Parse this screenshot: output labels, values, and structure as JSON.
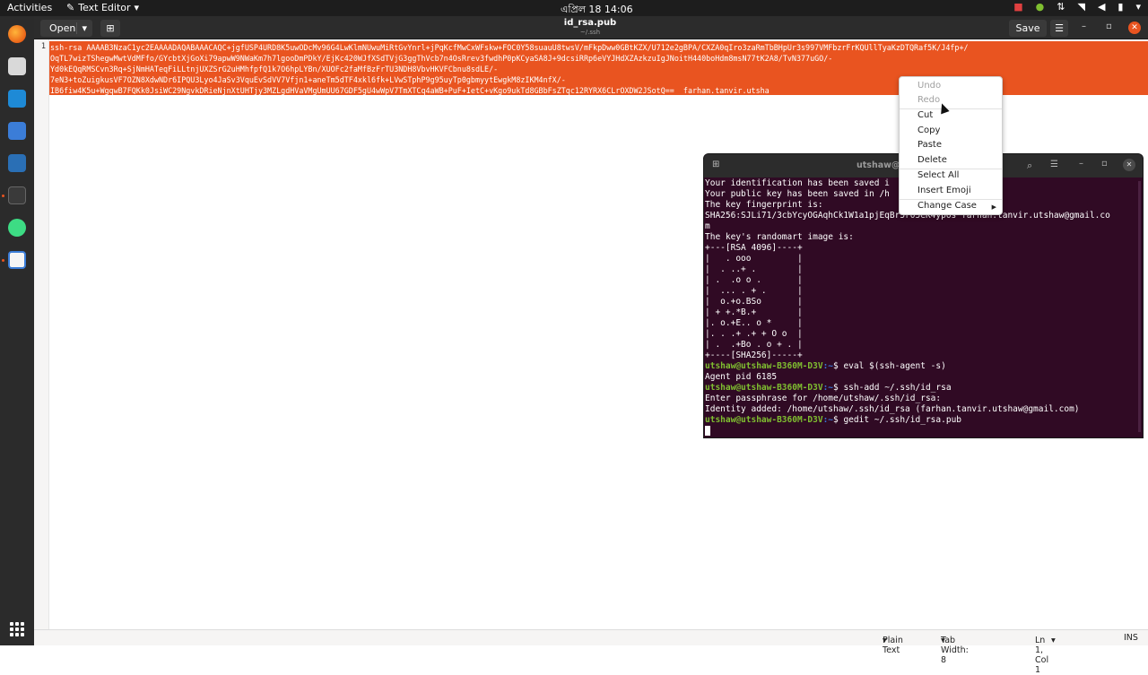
{
  "topbar": {
    "activities": "Activities",
    "app_name": "Text Editor",
    "clock": "এপ্রিল 18  14:06"
  },
  "editor": {
    "open_label": "Open",
    "title": "id_rsa.pub",
    "subtitle": "~/.ssh",
    "save_label": "Save",
    "line_number": "1",
    "lines": [
      "ssh-rsa AAAAB3NzaC1yc2EAAAADAQABAAACAQC+jgfUSP4URD8K5uwODcMv96G4LwKlmNUwuMiRtGvYnrl+jPqKcfMwCxWFskw+FOC0Y58suauU8twsV/mFkpDww0GBtKZX/U712e2gBPA/CXZA0qIro3zaRmTbBHpUr3s997VMFbzrFrKQUllTyaKzDTQRaf5K/J4fp+/",
      "OqTL7wizTShegwMwtVdMFfo/GYcbtXjGoXi79apwW9NWaKm7h7lgooDmPDkY/EjKc420WJfXSdTVjG3ggThVcb7n4OsRrev3fwdhP0pKCyaSA8J+9dcsiRRp6eVYJHdXZAzkzuIgJNoitH440boHdm8msN77tK2A8/TvN377uGO/-",
      "Yd0kEQqRMSCvn3Rq+SjNmHATeqFiLLtnjUXZSrG2uHMhfpfQ1k7O6hpLYBn/XUOFc2faMfBzFrTU3NDH8VbvHKVFCbnu8sdLE/-",
      "7eN3+toZuigkusVF7OZN8XdwNDr6IPQU3Lyo4JaSv3VquEvSdVV7Vfjn1+aneTm5dTF4xkl6fk+LVwSTphP9g95uyTp0gbmyytEwgkM8zIKM4nfX/-",
      "IB6fiw4K5u+WgqwB7FQKk0JsiWC29NgvkDRieNjnXtUHTjy3MZLgdHVaVMgUmUU67GDF5gU4wWpV7TmXTCq4aWB+PuF+IetC+vKgo9ukTd8GBbFsZTqc12RYRX6CLrOXDW2JSotQ==  farhan.tanvir.utsha"
    ],
    "statusbar": {
      "language": "Plain Text",
      "tab_width": "Tab Width: 8",
      "position": "Ln 1, Col 1",
      "mode": "INS"
    }
  },
  "terminal": {
    "title": "utshaw@u",
    "lines": [
      "Your identification has been saved i          /id_rsa",
      "Your public key has been saved in /h          rsa.pub",
      "The key fingerprint is:",
      "SHA256:SJLi71/3cbYcyOGAqhCk1W1a1pjEqBr5r05eK4ypOs farhan.tanvir.utshaw@gmail.co",
      "m",
      "The key's randomart image is:",
      "+---[RSA 4096]----+",
      "|   . ooo         |",
      "|  . ..+ .        |",
      "| .  .o o .       |",
      "|  ... . + .      |",
      "|  o.+o.BSo       |",
      "| + +.*B.+        |",
      "|. o.+E.. o *     |",
      "|. . .+ .+ + O o  |",
      "| .  .+Bo . o + . |",
      "+----[SHA256]-----+"
    ],
    "prompt_user": "utshaw@utshaw-B360M-D3V",
    "prompt_path": ":~",
    "cmd1": "$ eval $(ssh-agent -s)",
    "out1": "Agent pid 6185",
    "cmd2": "$ ssh-add ~/.ssh/id_rsa",
    "out2a": "Enter passphrase for /home/utshaw/.ssh/id_rsa:",
    "out2b": "Identity added: /home/utshaw/.ssh/id_rsa (farhan.tanvir.utshaw@gmail.com)",
    "cmd3": "$ gedit ~/.ssh/id_rsa.pub"
  },
  "context_menu": {
    "items": [
      "Undo",
      "Redo",
      "Cut",
      "Copy",
      "Paste",
      "Delete",
      "Select All",
      "Insert Emoji",
      "Change Case"
    ]
  },
  "colors": {
    "selection": "#e95420",
    "terminal_bg": "#300a24",
    "prompt_green": "#7fbf30",
    "prompt_blue": "#3875d7"
  }
}
